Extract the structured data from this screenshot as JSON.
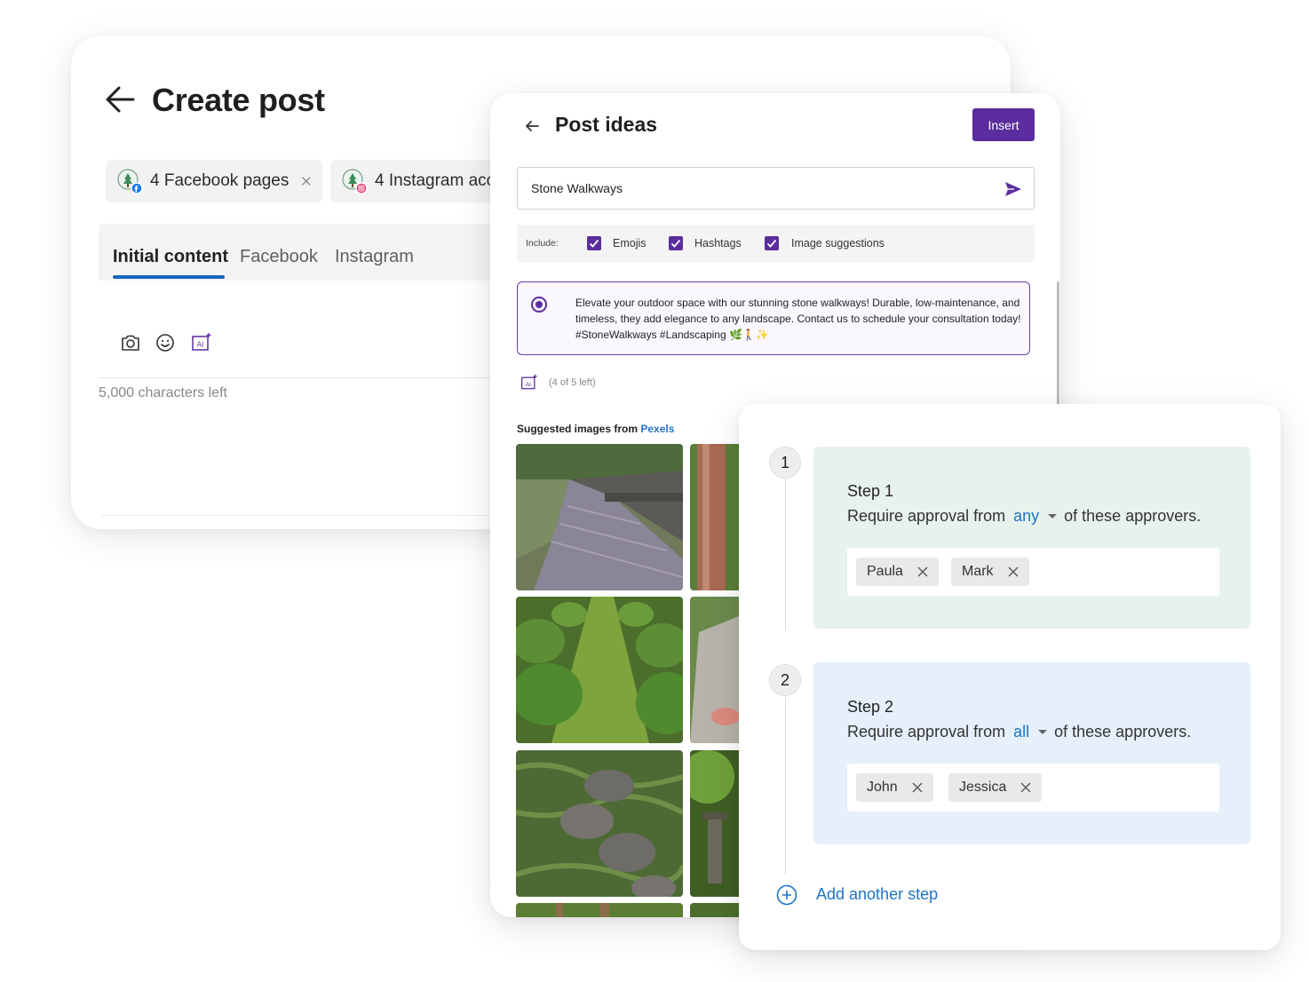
{
  "create_post": {
    "title": "Create post",
    "accounts": [
      {
        "label": "4 Facebook pages"
      },
      {
        "label": "4 Instagram acc"
      }
    ],
    "tabs": [
      "Initial content",
      "Facebook",
      "Instagram"
    ],
    "characters_left": "5,000 characters left",
    "ai_icon_text": "AI"
  },
  "post_ideas": {
    "title": "Post ideas",
    "insert_label": "Insert",
    "topic_value": "Stone Walkways",
    "include": {
      "label": "Include:",
      "options": [
        "Emojis",
        "Hashtags",
        "Image suggestions"
      ]
    },
    "suggestion": "Elevate your outdoor space with our stunning stone walkways! Durable, low-maintenance, and timeless, they add elegance to any landscape. Contact us to schedule your consultation today! #StoneWalkways #Landscaping 🌿🚶✨",
    "remaining": "(4 of 5 left)",
    "suggested_prefix": "Suggested images from ",
    "suggested_source": "Pexels",
    "ai_icon_text": "AI"
  },
  "approval": {
    "steps": [
      {
        "number": "1",
        "title": "Step 1",
        "prefix": "Require approval from",
        "quantifier": "any",
        "suffix": "of these approvers.",
        "approvers": [
          "Paula",
          "Mark"
        ]
      },
      {
        "number": "2",
        "title": "Step 2",
        "prefix": "Require approval from",
        "quantifier": "all",
        "suffix": "of these approvers.",
        "approvers": [
          "John",
          "Jessica"
        ]
      }
    ],
    "add_step_label": "Add another step"
  },
  "colors": {
    "brand_purple": "#5b2d9e",
    "link_blue": "#1e74c6",
    "tab_underline": "#1565c0",
    "step1_bg": "#e8f2ec",
    "step2_bg": "#e5f0fb"
  }
}
